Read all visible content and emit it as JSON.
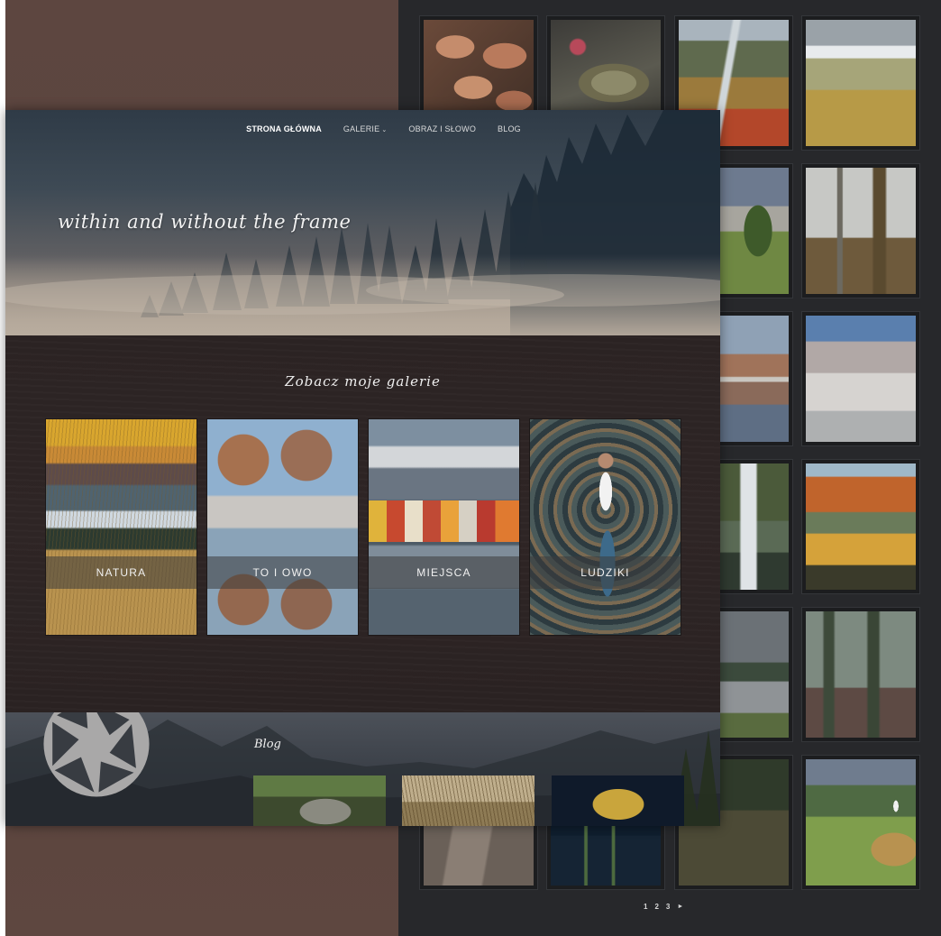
{
  "site": {
    "nav": {
      "items": [
        {
          "label": "STRONA GŁÓWNA",
          "active": true
        },
        {
          "label": "GALERIE",
          "has_dropdown": true
        },
        {
          "label": "OBRAZ I SŁOWO"
        },
        {
          "label": "BLOG"
        }
      ]
    },
    "hero": {
      "title": "within and without the frame"
    },
    "gallery": {
      "heading": "Zobacz moje galerie",
      "cards": [
        {
          "label": "NATURA"
        },
        {
          "label": "TO I OWO"
        },
        {
          "label": "MIEJSCA"
        },
        {
          "label": "LUDZIKI"
        }
      ]
    },
    "blog": {
      "title": "Blog"
    }
  },
  "pager": {
    "pages": [
      "1",
      "2",
      "3"
    ],
    "next_icon": "next-arrow-icon",
    "next_glyph": "►"
  },
  "colors": {
    "left_panel": "#5d4640",
    "right_panel": "#27282b",
    "gallery_bg": "#2b2323",
    "text_light": "#f2f2f2"
  }
}
